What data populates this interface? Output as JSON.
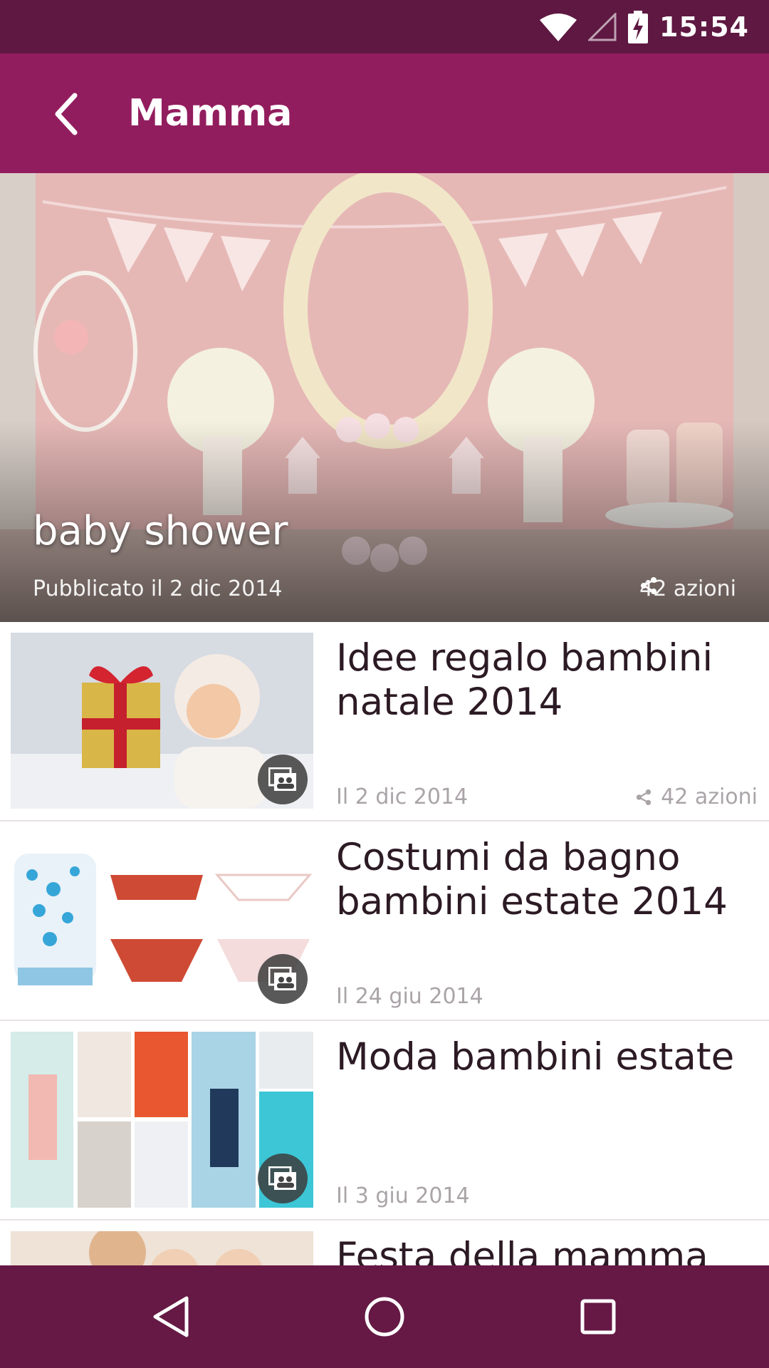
{
  "status_bar": {
    "time": "15:54",
    "icons": [
      "wifi-icon",
      "cell-signal-icon",
      "battery-charging-icon"
    ]
  },
  "app_bar": {
    "title": "Mamma",
    "back_icon": "chevron-left-icon",
    "color": "#921d5e"
  },
  "hero": {
    "title": "baby shower",
    "date": "Pubblicato il 2 dic 2014",
    "shares": "42 azioni",
    "share_icon": "share-icon"
  },
  "articles": [
    {
      "title": "Idee regalo bambini natale 2014",
      "date": "Il 2 dic 2014",
      "shares": "42 azioni",
      "badge_icon": "gallery-icon"
    },
    {
      "title": "Costumi da bagno bambini estate 2014",
      "date": "Il 24 giu 2014",
      "shares": "",
      "badge_icon": "gallery-icon"
    },
    {
      "title": "Moda bambini estate",
      "date": "Il 3 giu 2014",
      "shares": "",
      "badge_icon": "gallery-icon"
    },
    {
      "title": "Festa della mamma",
      "date": "",
      "shares": ""
    }
  ],
  "nav_bar": {
    "icons": [
      "back-triangle-icon",
      "home-circle-icon",
      "recents-square-icon"
    ]
  },
  "colors": {
    "status_bar": "#5e1841",
    "app_bar": "#921d5e",
    "nav_bar": "#651944",
    "title_text": "#2c1a24",
    "meta_text": "#aaa4a8"
  }
}
